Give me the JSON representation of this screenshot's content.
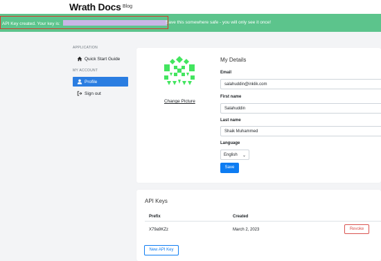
{
  "header": {
    "logo_text_1": "Wr",
    "logo_text_2": "ath D",
    "logo_text_3": "cs",
    "blog_link": "Blog"
  },
  "alert": {
    "prefix": "API Key created. Your key is:",
    "suffix": "Save this somewhere safe - you will only see it once!",
    "color": "#5cc48c",
    "outline_color": "#d33a2c"
  },
  "sidebar": {
    "application_heading": "APPLICATION",
    "quick_start": "Quick Start Guide",
    "my_account_heading": "MY ACCOUNT",
    "profile": "Profile",
    "sign_out": "Sign out"
  },
  "details": {
    "title": "My Details",
    "change_picture": "Change Picture",
    "email_label": "Email",
    "email_value": "salahuddin@inklik.com",
    "first_name_label": "First name",
    "first_name_value": "Salahuddin",
    "last_name_label": "Last name",
    "last_name_value": "Shaik Muhammed",
    "language_label": "Language",
    "language_value": "English",
    "save_button": "Save",
    "avatar_color": "#43e55f"
  },
  "api_keys": {
    "title": "API Keys",
    "col_prefix": "Prefix",
    "col_created": "Created",
    "rows": [
      {
        "prefix": "X79a9KZz",
        "created": "March 2, 2023",
        "action": "Revoke"
      }
    ],
    "new_key_button": "New API Key"
  }
}
